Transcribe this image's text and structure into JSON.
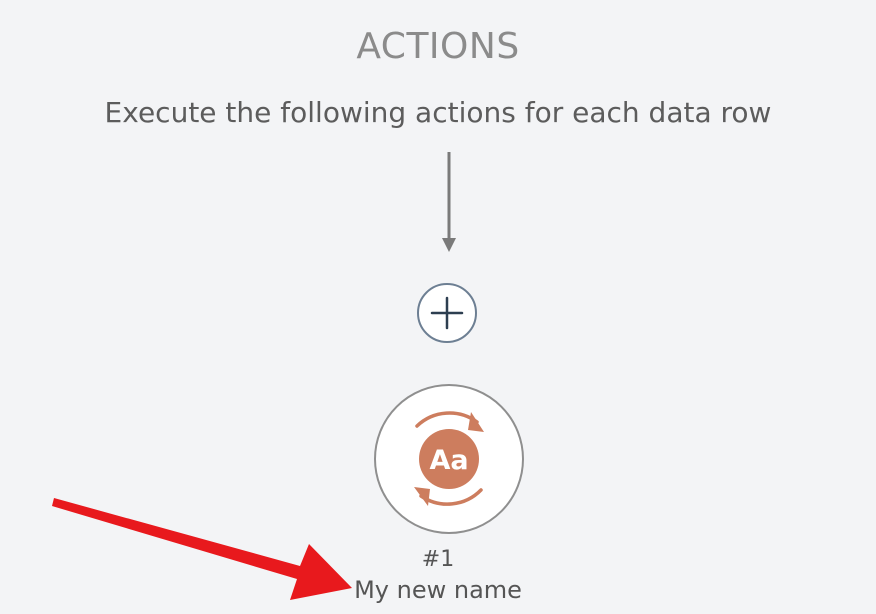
{
  "actions_section": {
    "title": "ACTIONS",
    "subtitle": "Execute the following actions for each data row"
  },
  "add_action": {
    "icon": "plus-icon"
  },
  "action_node": {
    "icon": "rename-text-icon",
    "icon_glyph": "Aa",
    "number": "#1",
    "name": "My new name",
    "accent_color": "#cd7d5e"
  },
  "annotation": {
    "icon": "red-callout-arrow",
    "color": "#e8191d"
  }
}
